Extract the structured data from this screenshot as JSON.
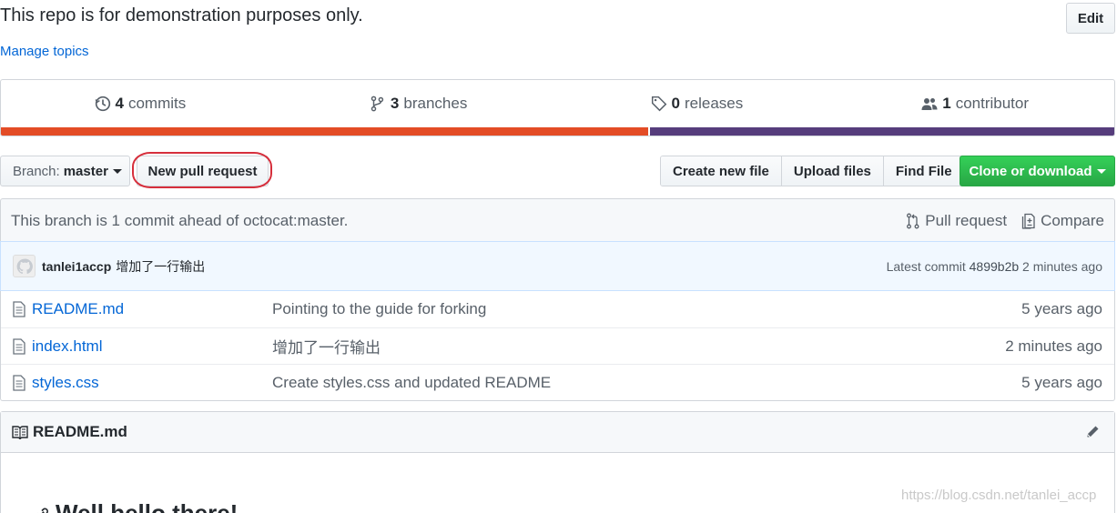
{
  "repo": {
    "description": "This repo is for demonstration purposes only.",
    "manage_topics": "Manage topics",
    "edit_label": "Edit"
  },
  "summary": {
    "commits": {
      "count": "4",
      "label": "commits"
    },
    "branches": {
      "count": "3",
      "label": "branches"
    },
    "releases": {
      "count": "0",
      "label": "releases"
    },
    "contributors": {
      "count": "1",
      "label": "contributor"
    },
    "language_colors": [
      "#e34c26",
      "#563d7c"
    ],
    "language_fractions": [
      0.581,
      0.419
    ]
  },
  "toolbar": {
    "branch_prefix": "Branch:",
    "branch_name": "master",
    "new_pull_request": "New pull request",
    "create_new_file": "Create new file",
    "upload_files": "Upload files",
    "find_file": "Find File",
    "clone_or_download": "Clone or download"
  },
  "branch_status": {
    "text": "This branch is 1 commit ahead of octocat:master.",
    "pull_request": "Pull request",
    "compare": "Compare"
  },
  "latest_commit": {
    "author": "tanlei1accp",
    "message": "增加了一行输出",
    "prefix": "Latest commit",
    "sha": "4899b2b",
    "age": "2 minutes ago"
  },
  "files": [
    {
      "name": "README.md",
      "message": "Pointing to the guide for forking",
      "age": "5 years ago"
    },
    {
      "name": "index.html",
      "message": "增加了一行输出",
      "age": "2 minutes ago"
    },
    {
      "name": "styles.css",
      "message": "Create styles.css and updated README",
      "age": "5 years ago"
    }
  ],
  "readme": {
    "filename": "README.md",
    "heading": "Well hello there!"
  },
  "watermark": "https://blog.csdn.net/tanlei_accp",
  "colors": {
    "link": "#0366d6",
    "clone_green": "#28a745",
    "highlight_red": "#d62f3c"
  }
}
